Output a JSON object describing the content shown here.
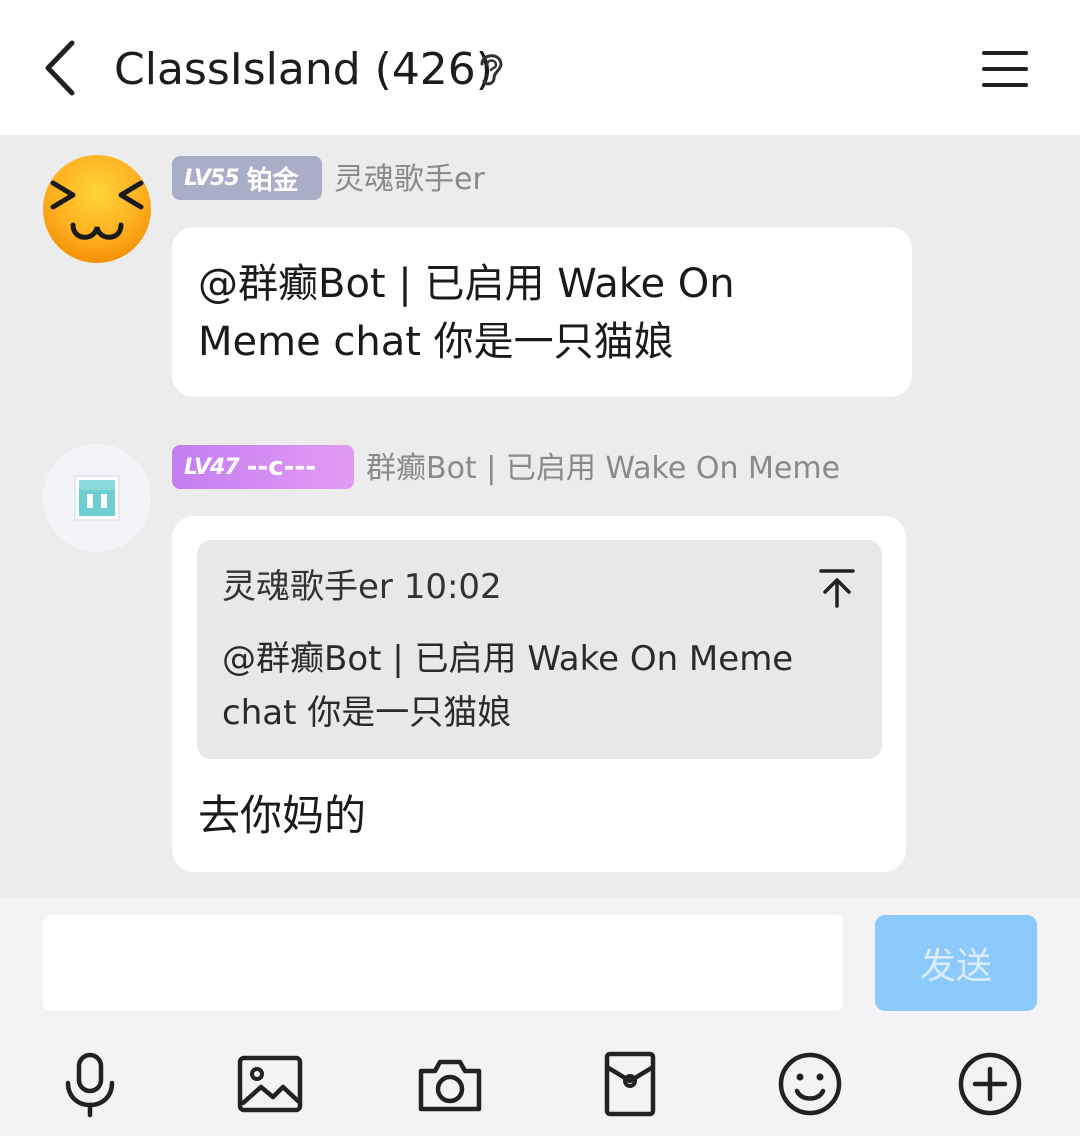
{
  "header": {
    "title": "ClassIsland (426)",
    "back_icon": "chevron-left-icon",
    "ear_icon": "ear-icon",
    "menu_icon": "hamburger-menu-icon"
  },
  "messages": [
    {
      "badge_level": "LV55",
      "badge_title": "铂金",
      "badge_color": "#a8adc8",
      "sender": "灵魂歌手er",
      "text_line1": "@群癫Bot | 已启用 Wake On",
      "text_line2": "Meme chat 你是一只猫娘"
    },
    {
      "badge_level": "LV47",
      "badge_title": "--c---",
      "badge_color": "#c37ef0",
      "sender": "群癫Bot | 已启用 Wake On Meme",
      "quote_header": "灵魂歌手er 10:02",
      "quote_line1": "@群癫Bot | 已启用 Wake On Meme",
      "quote_line2": "chat 你是一只猫娘",
      "reply_text": "去你妈的"
    }
  ],
  "composer": {
    "input_value": "",
    "send_label": "发送",
    "send_color": "#8cc9fc"
  },
  "toolbar": {
    "icons": [
      "microphone-icon",
      "image-icon",
      "camera-icon",
      "red-packet-icon",
      "emoji-icon",
      "plus-icon"
    ]
  }
}
